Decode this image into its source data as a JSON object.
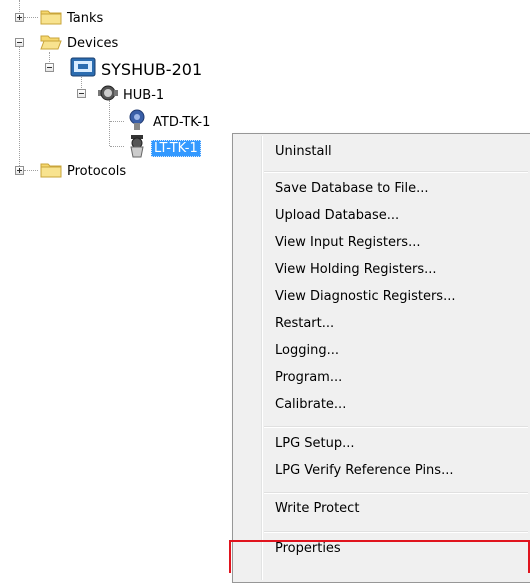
{
  "tree": {
    "tanks": "Tanks",
    "devices": "Devices",
    "syshub": "SYSHUB-201",
    "hub": "HUB-1",
    "atd": "ATD-TK-1",
    "lt": "LT-TK-1",
    "protocols": "Protocols"
  },
  "menu": {
    "items": [
      "Uninstall",
      "Save Database to File...",
      "Upload Database...",
      "View Input Registers...",
      "View Holding Registers...",
      "View Diagnostic Registers...",
      "Restart...",
      "Logging...",
      "Program...",
      "Calibrate...",
      "LPG Setup...",
      "LPG Verify Reference Pins...",
      "Write Protect",
      "Properties"
    ]
  },
  "colors": {
    "selection": "#3399ff",
    "highlight_box": "#e0141e",
    "menu_bg": "#f0f0f0"
  }
}
